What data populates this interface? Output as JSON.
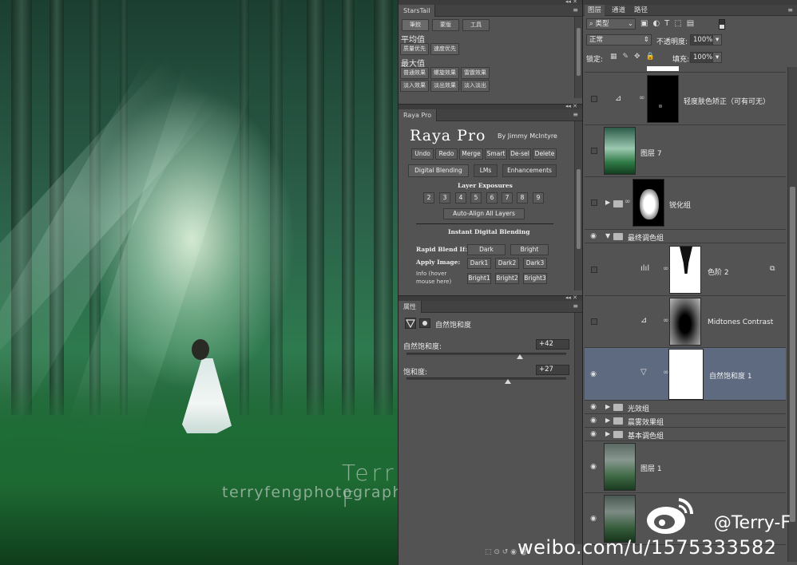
{
  "canvas": {
    "watermark_name": "Terry F",
    "watermark_url": "terryfengphotography.lofter.com"
  },
  "starstail": {
    "title": "StarsTail",
    "tabs": [
      "筆鉸",
      "蒙版",
      "工具"
    ],
    "section_avg": "平均值",
    "avg_buttons": [
      "质量优先",
      "速度优先"
    ],
    "section_max": "最大值",
    "max_buttons": [
      "普通效果",
      "螺旋效果",
      "雷霆效果",
      "淡入效果",
      "淡出效果",
      "淡入淡出"
    ]
  },
  "raya": {
    "tab": "Raya Pro",
    "title": "Raya Pro",
    "by": "By Jimmy McIntyre",
    "actions": [
      "Undo",
      "Redo",
      "Merge",
      "Smart",
      "De-sel",
      "Delete"
    ],
    "tabs": [
      "Digital Blending",
      "LMs",
      "Enhancements"
    ],
    "exposures_label": "Layer Exposures",
    "exposures": [
      "2",
      "3",
      "4",
      "5",
      "6",
      "7",
      "8",
      "9"
    ],
    "auto_align": "Auto-Align All Layers",
    "instant_label": "Instant Digital Blending",
    "rapid_label": "Rapid Blend If:",
    "rapid_buttons": [
      "Dark",
      "Bright"
    ],
    "apply_label": "Apply Image:",
    "apply_buttons": [
      "Dark1",
      "Dark2",
      "Dark3",
      "Bright1",
      "Bright2",
      "Bright3"
    ],
    "info_label": "Info (hover mouse here)"
  },
  "properties": {
    "tab": "属性",
    "heading": "自然饱和度",
    "vibrance_label": "自然饱和度:",
    "vibrance_value": "+42",
    "vibrance_level": 0.71,
    "saturation_label": "饱和度:",
    "saturation_value": "+27",
    "saturation_level": 0.635
  },
  "layers": {
    "tabs": [
      "图层",
      "通道",
      "路径"
    ],
    "filter_label": "类型",
    "blend_mode": "正常",
    "opacity_label": "不透明度:",
    "opacity_value": "100%",
    "lock_label": "锁定:",
    "fill_label": "填充:",
    "fill_value": "100%",
    "items": [
      {
        "name": "轻度肤色矫正（可有可无）",
        "visible": false
      },
      {
        "name": "图层 7",
        "visible": false
      },
      {
        "name": "锐化组",
        "visible": false
      },
      {
        "name": "最终调色组",
        "visible": true
      },
      {
        "name": "色阶 2",
        "visible": false
      },
      {
        "name": "Midtones Contrast",
        "visible": false
      },
      {
        "name": "自然饱和度 1",
        "visible": true
      },
      {
        "name": "光效组",
        "visible": true
      },
      {
        "name": "晨雾效果组",
        "visible": true
      },
      {
        "name": "基本调色组",
        "visible": true
      },
      {
        "name": "图层 1",
        "visible": true
      },
      {
        "name": "",
        "visible": true
      }
    ]
  },
  "weibo": {
    "handle": "@Terry-F",
    "url": "weibo.com/u/1575333582"
  }
}
